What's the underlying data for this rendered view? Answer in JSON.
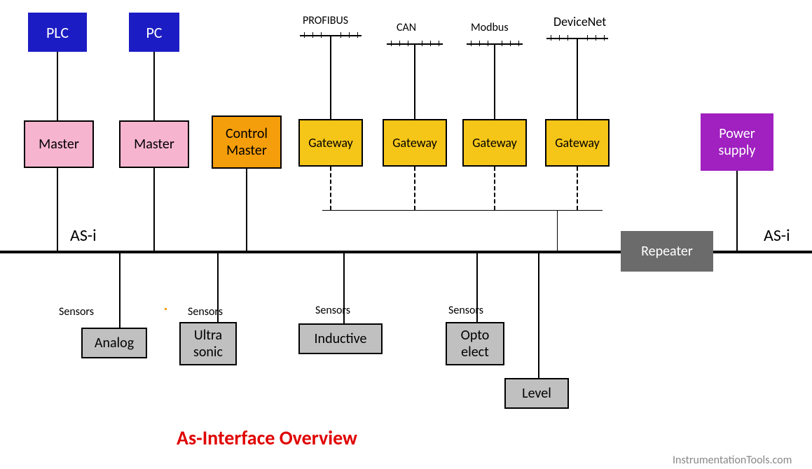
{
  "top_left_boxes": {
    "plc": "PLC",
    "pc": "PC"
  },
  "masters": {
    "m1": "Master",
    "m2": "Master",
    "control": "Control\nMaster"
  },
  "gateways": {
    "g1": {
      "label": "Gateway",
      "bus_label": "PROFIBUS"
    },
    "g2": {
      "label": "Gateway",
      "bus_label": "CAN"
    },
    "g3": {
      "label": "Gateway",
      "bus_label": "Modbus"
    },
    "g4": {
      "label": "Gateway",
      "bus_label": "DeviceNet"
    }
  },
  "right": {
    "power": "Power\nsupply",
    "repeater": "Repeater"
  },
  "as_i_left": "AS-i",
  "as_i_right": "AS-i",
  "sensors_label": "Sensors",
  "sensors": {
    "analog": "Analog",
    "ultra": "Ultra\nsonic",
    "inductive": "Inductive",
    "opto": "Opto\nelect",
    "level": "Level"
  },
  "title": "As-Interface Overview",
  "source": "InstrumentationTools.com"
}
